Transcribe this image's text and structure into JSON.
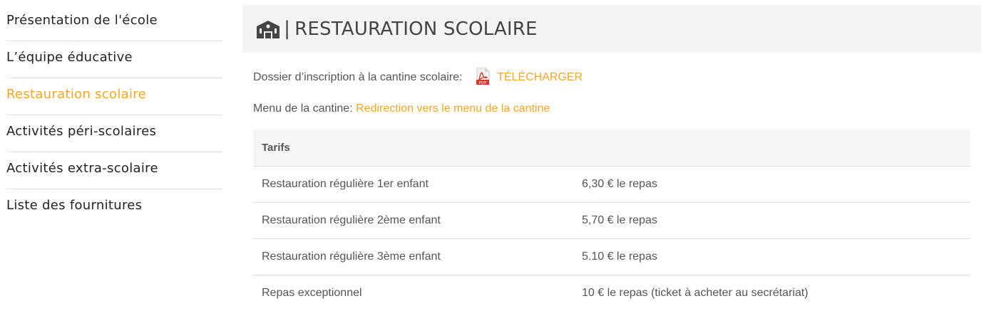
{
  "sidebar": {
    "items": [
      {
        "label": "Présentation de l'école"
      },
      {
        "label": "L’équipe éducative"
      },
      {
        "label": "Restauration scolaire"
      },
      {
        "label": "Activités péri-scolaires"
      },
      {
        "label": "Activités extra-scolaire"
      },
      {
        "label": "Liste des fournitures"
      }
    ],
    "active_index": 2
  },
  "header": {
    "separator": "|",
    "title": "RESTAURATION SCOLAIRE",
    "icon": "school-building-icon"
  },
  "content": {
    "dossier_label": "Dossier d’inscription à la cantine scolaire:",
    "download_label": "TÉLÉCHARGER",
    "download_icon": "pdf-icon",
    "menu_label": "Menu de la cantine:",
    "menu_link": "Redirection vers le menu de la cantine"
  },
  "table": {
    "header": "Tarifs",
    "rows": [
      {
        "label": "Restauration régulière 1er enfant",
        "price": "6,30 € le repas"
      },
      {
        "label": "Restauration régulière 2ème enfant",
        "price": "5,70 € le repas"
      },
      {
        "label": "Restauration régulière 3ème enfant",
        "price": "5.10 € le repas"
      },
      {
        "label": "Repas exceptionnel",
        "price": "10 € le repas (ticket à acheter au secrétariat)"
      }
    ]
  },
  "colors": {
    "accent": "#f5a623",
    "pdf_red": "#d9372b"
  }
}
